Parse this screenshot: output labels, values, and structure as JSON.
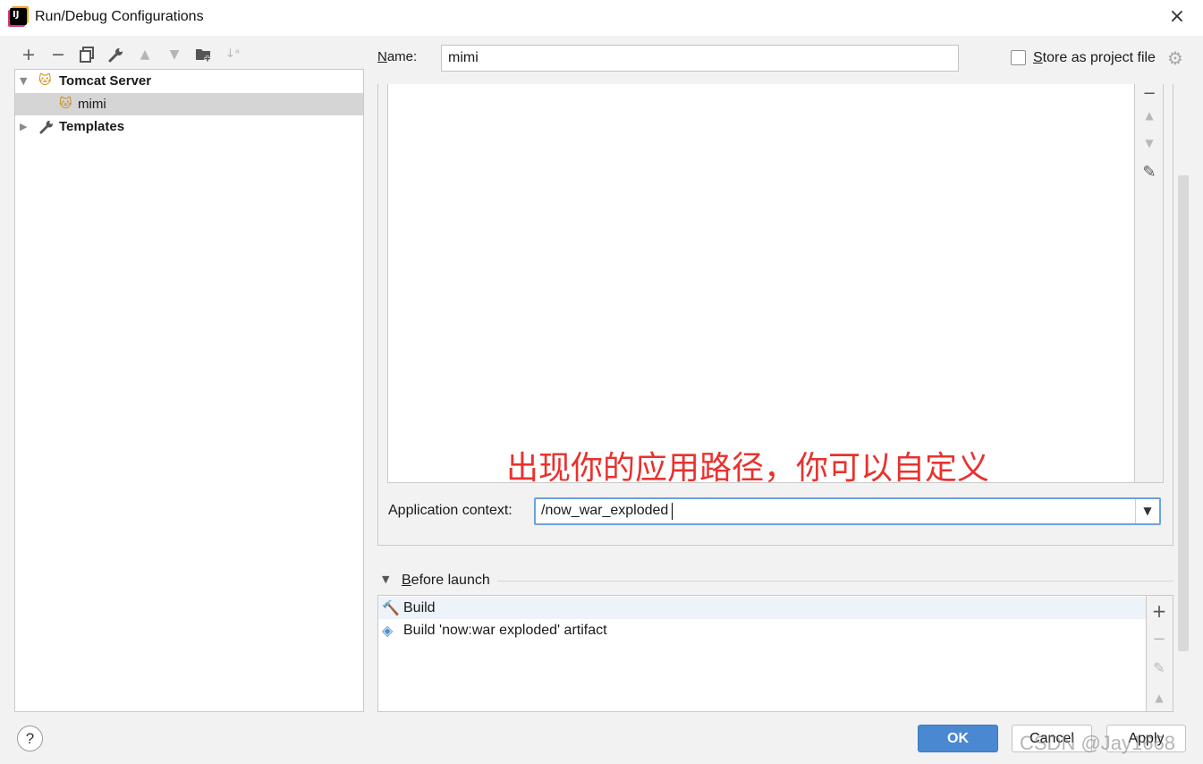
{
  "window": {
    "title": "Run/Debug Configurations",
    "app_icon": "intellij-idea-icon",
    "close_icon": "×"
  },
  "toolbar": {
    "add": "+",
    "remove": "−",
    "copy": "⧉",
    "edit_templates": "wrench-icon",
    "move_up": "▲",
    "move_down": "▼",
    "new_folder": "folder-plus-icon",
    "sort": "sort-az-icon"
  },
  "tree": {
    "items": [
      {
        "label": "Tomcat Server",
        "expanded": true,
        "icon": "tomcat-icon"
      },
      {
        "label": "mimi",
        "selected": true,
        "icon": "tomcat-icon"
      },
      {
        "label": "Templates",
        "expanded": false,
        "icon": "wrench-icon"
      }
    ]
  },
  "name_field": {
    "label": "Name:",
    "value": "mimi"
  },
  "store_option": {
    "label": "Store as project file",
    "checked": false
  },
  "deployment": {
    "side_tools": {
      "remove": "−",
      "up": "▲",
      "down": "▼",
      "edit": "✎"
    }
  },
  "annotation": "出现你的应用路径，你可以自定义",
  "app_context": {
    "label": "Application context:",
    "value": "/now_war_exploded",
    "arrow": "▼"
  },
  "before_launch": {
    "label": "Before launch",
    "items": [
      {
        "label": "Build",
        "icon": "hammer-icon"
      },
      {
        "label": "Build 'now:war exploded' artifact",
        "icon": "artifact-icon"
      }
    ],
    "tools": {
      "add": "+",
      "remove": "−",
      "edit": "✎",
      "up": "▲"
    }
  },
  "footer": {
    "help": "?",
    "ok": "OK",
    "cancel": "Cancel",
    "apply": "Apply",
    "watermark": "CSDN @Jay1668"
  },
  "colors": {
    "accent": "#4a88d2",
    "annotation": "#e8322e",
    "selection": "#d5d5d5",
    "focus_border": "#6ca2e0"
  }
}
